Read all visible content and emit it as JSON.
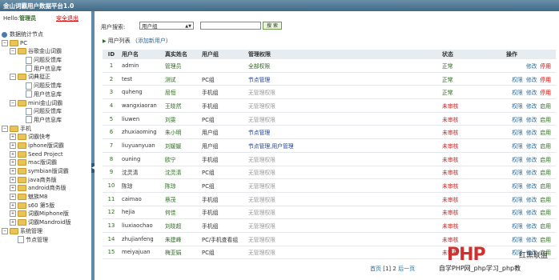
{
  "app": {
    "title": "金山词霸用户数据平台1.0"
  },
  "sidebar": {
    "hello_prefix": "Hello:",
    "user": "管理员",
    "logout": "安全退出",
    "tree": [
      {
        "label": "数据统计节点",
        "level": 0,
        "kind": "root"
      },
      {
        "label": "PC",
        "level": 0,
        "kind": "folder",
        "pm": "-"
      },
      {
        "label": "谷歌金山词霸",
        "level": 1,
        "kind": "folder",
        "pm": "-"
      },
      {
        "label": "问题反馈库",
        "level": 2,
        "kind": "doc"
      },
      {
        "label": "用户信息库",
        "level": 2,
        "kind": "doc"
      },
      {
        "label": "词典挺正",
        "level": 1,
        "kind": "folder",
        "pm": "-"
      },
      {
        "label": "问题反馈库",
        "level": 2,
        "kind": "doc"
      },
      {
        "label": "用户信息库",
        "level": 2,
        "kind": "doc"
      },
      {
        "label": "mini金山词霸",
        "level": 1,
        "kind": "folder",
        "pm": "-"
      },
      {
        "label": "问题反馈库",
        "level": 2,
        "kind": "doc"
      },
      {
        "label": "用户信息库",
        "level": 2,
        "kind": "doc"
      },
      {
        "label": "手机",
        "level": 0,
        "kind": "folder",
        "pm": "-"
      },
      {
        "label": "词霸快考",
        "level": 1,
        "kind": "folder",
        "pm": "+"
      },
      {
        "label": "iphone版词霸",
        "level": 1,
        "kind": "folder",
        "pm": "+"
      },
      {
        "label": "Seed Project",
        "level": 1,
        "kind": "folder",
        "pm": "+"
      },
      {
        "label": "mac版词霸",
        "level": 1,
        "kind": "folder",
        "pm": "+"
      },
      {
        "label": "symbian版词霸",
        "level": 1,
        "kind": "folder",
        "pm": "+"
      },
      {
        "label": "java商务版",
        "level": 1,
        "kind": "folder",
        "pm": "+"
      },
      {
        "label": "android商务版",
        "level": 1,
        "kind": "folder",
        "pm": "+"
      },
      {
        "label": "魅族M8",
        "level": 1,
        "kind": "folder",
        "pm": "+"
      },
      {
        "label": "s60 第5版",
        "level": 1,
        "kind": "folder",
        "pm": "+"
      },
      {
        "label": "词霸Miphone版",
        "level": 1,
        "kind": "folder",
        "pm": "+"
      },
      {
        "label": "词霸Mandroid版",
        "level": 1,
        "kind": "folder",
        "pm": "+"
      },
      {
        "label": "系统管理",
        "level": 0,
        "kind": "folder",
        "pm": "-"
      },
      {
        "label": "节点管理",
        "level": 1,
        "kind": "doc"
      }
    ]
  },
  "search": {
    "label": "用户搜索:",
    "select_value": "用户组",
    "input_value": "",
    "button": "搜 索"
  },
  "list": {
    "title": "用户列表",
    "add_link": "添加新用户",
    "open_paren": "（",
    "close_paren": "）",
    "columns": [
      "ID",
      "用户名",
      "真实姓名",
      "用户组",
      "管理权限",
      "状态",
      "操作"
    ],
    "rows": [
      {
        "id": "1",
        "username": "admin",
        "realname": "管理员",
        "group": "",
        "perm": "全部权限",
        "perm_kind": "all",
        "status": "正常",
        "ops": [
          "修改",
          "停用"
        ]
      },
      {
        "id": "2",
        "username": "test",
        "realname": "测试",
        "group": "PC组",
        "perm": "节点管理",
        "perm_kind": "node",
        "status": "正常",
        "ops": [
          "权限",
          "修改",
          "停用"
        ]
      },
      {
        "id": "3",
        "username": "quheng",
        "realname": "屈恒",
        "group": "手机组",
        "perm": "无管理权限",
        "perm_kind": "none",
        "status": "正常",
        "ops": [
          "权限",
          "修改",
          "停用"
        ]
      },
      {
        "id": "4",
        "username": "wangxiaoran",
        "realname": "王晓然",
        "group": "手机组",
        "perm": "无管理权限",
        "perm_kind": "none",
        "status": "未审核",
        "ops": [
          "权限",
          "修改",
          "启用"
        ]
      },
      {
        "id": "5",
        "username": "liuwen",
        "realname": "刘雯",
        "group": "PC组",
        "perm": "无管理权限",
        "perm_kind": "none",
        "status": "未审核",
        "ops": [
          "权限",
          "修改",
          "启用"
        ]
      },
      {
        "id": "6",
        "username": "zhuxiaoming",
        "realname": "朱小明",
        "group": "用户组",
        "perm": "节点管理",
        "perm_kind": "node",
        "status": "未审核",
        "ops": [
          "权限",
          "修改",
          "启用"
        ]
      },
      {
        "id": "7",
        "username": "liuyuanyuan",
        "realname": "刘媛媛",
        "group": "用户组",
        "perm": "节点管理,用户管理",
        "perm_kind": "node",
        "status": "未审核",
        "ops": [
          "权限",
          "修改",
          "启用"
        ]
      },
      {
        "id": "8",
        "username": "ouning",
        "realname": "欧宁",
        "group": "手机组",
        "perm": "无管理权限",
        "perm_kind": "none",
        "status": "未审核",
        "ops": [
          "权限",
          "修改",
          "启用"
        ]
      },
      {
        "id": "9",
        "username": "沈灵清",
        "realname": "沈灵清",
        "group": "PC组",
        "perm": "无管理权限",
        "perm_kind": "none",
        "status": "未审核",
        "ops": [
          "权限",
          "修改",
          "启用"
        ]
      },
      {
        "id": "10",
        "username": "陈琼",
        "realname": "陈琼",
        "group": "PC组",
        "perm": "无管理权限",
        "perm_kind": "none",
        "status": "未审核",
        "ops": [
          "权限",
          "修改",
          "启用"
        ]
      },
      {
        "id": "11",
        "username": "caimao",
        "realname": "蔡茂",
        "group": "手机组",
        "perm": "无管理权限",
        "perm_kind": "none",
        "status": "未审核",
        "ops": [
          "权限",
          "修改",
          "启用"
        ]
      },
      {
        "id": "12",
        "username": "hejia",
        "realname": "何佳",
        "group": "手机组",
        "perm": "无管理权限",
        "perm_kind": "none",
        "status": "未审核",
        "ops": [
          "权限",
          "修改",
          "启用"
        ]
      },
      {
        "id": "13",
        "username": "liuxiaochao",
        "realname": "刘晓超",
        "group": "手机组",
        "perm": "无管理权限",
        "perm_kind": "none",
        "status": "未审核",
        "ops": [
          "权限",
          "修改",
          "启用"
        ]
      },
      {
        "id": "14",
        "username": "zhujianfeng",
        "realname": "朱建峰",
        "group": "PC/手机查看组",
        "perm": "无管理权限",
        "perm_kind": "none",
        "status": "未审核",
        "ops": [
          "权限",
          "修改",
          "启用"
        ]
      },
      {
        "id": "15",
        "username": "meiyajuan",
        "realname": "梅亚娟",
        "group": "PC组",
        "perm": "无管理权限",
        "perm_kind": "none",
        "status": "未审核",
        "ops": [
          "权限",
          "修改",
          "启用"
        ]
      }
    ]
  },
  "pager": {
    "first": "首页",
    "pages": "[1] 2",
    "next": "后一页"
  },
  "watermark": {
    "logo": "PHP",
    "brand": "红黑联盟",
    "site": "自学PHP网_php学习_php教"
  },
  "colors": {
    "topbar": "#3f6a86",
    "green": "#2c6a1f",
    "red": "#d02020",
    "link": "#2c6a9a"
  }
}
